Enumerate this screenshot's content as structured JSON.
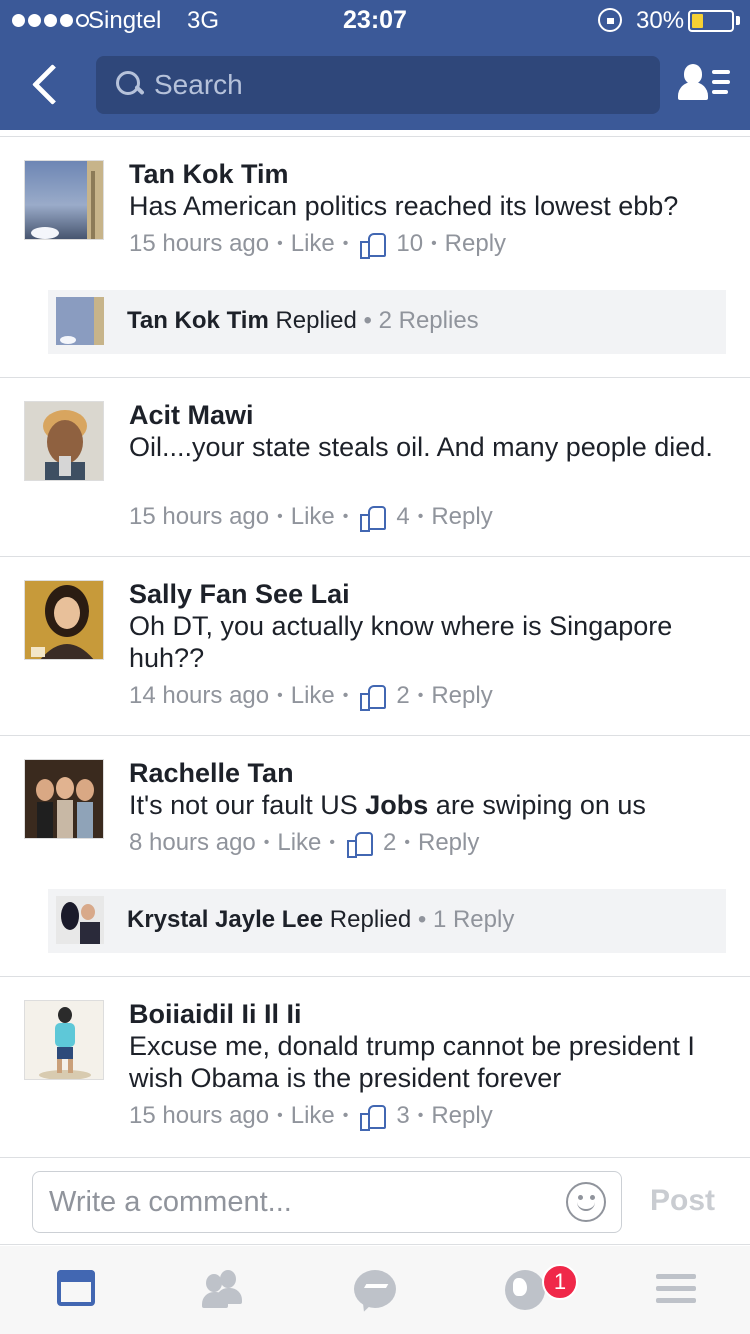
{
  "status_bar": {
    "carrier": "Singtel",
    "network": "3G",
    "time": "23:07",
    "battery": "30%",
    "battery_level": 0.3,
    "signal_strength": 4
  },
  "nav": {
    "search_placeholder": "Search",
    "brand_color": "#3b5998"
  },
  "comments": [
    {
      "name": "Tan Kok Tim",
      "text": "Has American politics reached its lowest ebb?",
      "time": "15 hours ago",
      "like": "Like",
      "likes": "10",
      "reply": "Reply",
      "replies": {
        "name": "Tan Kok Tim",
        "action": "Replied",
        "count": "2 Replies"
      }
    },
    {
      "name": "Acit Mawi",
      "text": "Oil....your state steals oil. And many people died.",
      "time": "15 hours ago",
      "like": "Like",
      "likes": "4",
      "reply": "Reply"
    },
    {
      "name": "Sally Fan See Lai",
      "text": "Oh DT, you actually know where is Singapore huh??",
      "time": "14 hours ago",
      "like": "Like",
      "likes": "2",
      "reply": "Reply"
    },
    {
      "name": "Rachelle Tan",
      "text_before": "It's not our fault US ",
      "text_bold": "Jobs",
      "text_after": " are swiping on us",
      "time": "8 hours ago",
      "like": "Like",
      "likes": "2",
      "reply": "Reply",
      "replies": {
        "name": "Krystal Jayle Lee",
        "action": "Replied",
        "count": "1 Reply"
      }
    },
    {
      "name": "Boiiaidil Ii Il Ii",
      "text": "Excuse me, donald trump cannot be president I wish Obama is the president forever",
      "time": "15 hours ago",
      "like": "Like",
      "likes": "3",
      "reply": "Reply"
    }
  ],
  "composer": {
    "placeholder": "Write a comment...",
    "post_label": "Post"
  },
  "tab_bar": {
    "tabs": [
      "news-feed-icon",
      "friend-requests-icon",
      "messenger-icon",
      "notifications-globe-icon",
      "menu-icon"
    ],
    "notification_badge": "1",
    "badge_color": "#f02849",
    "active_color": "#4267b2"
  }
}
